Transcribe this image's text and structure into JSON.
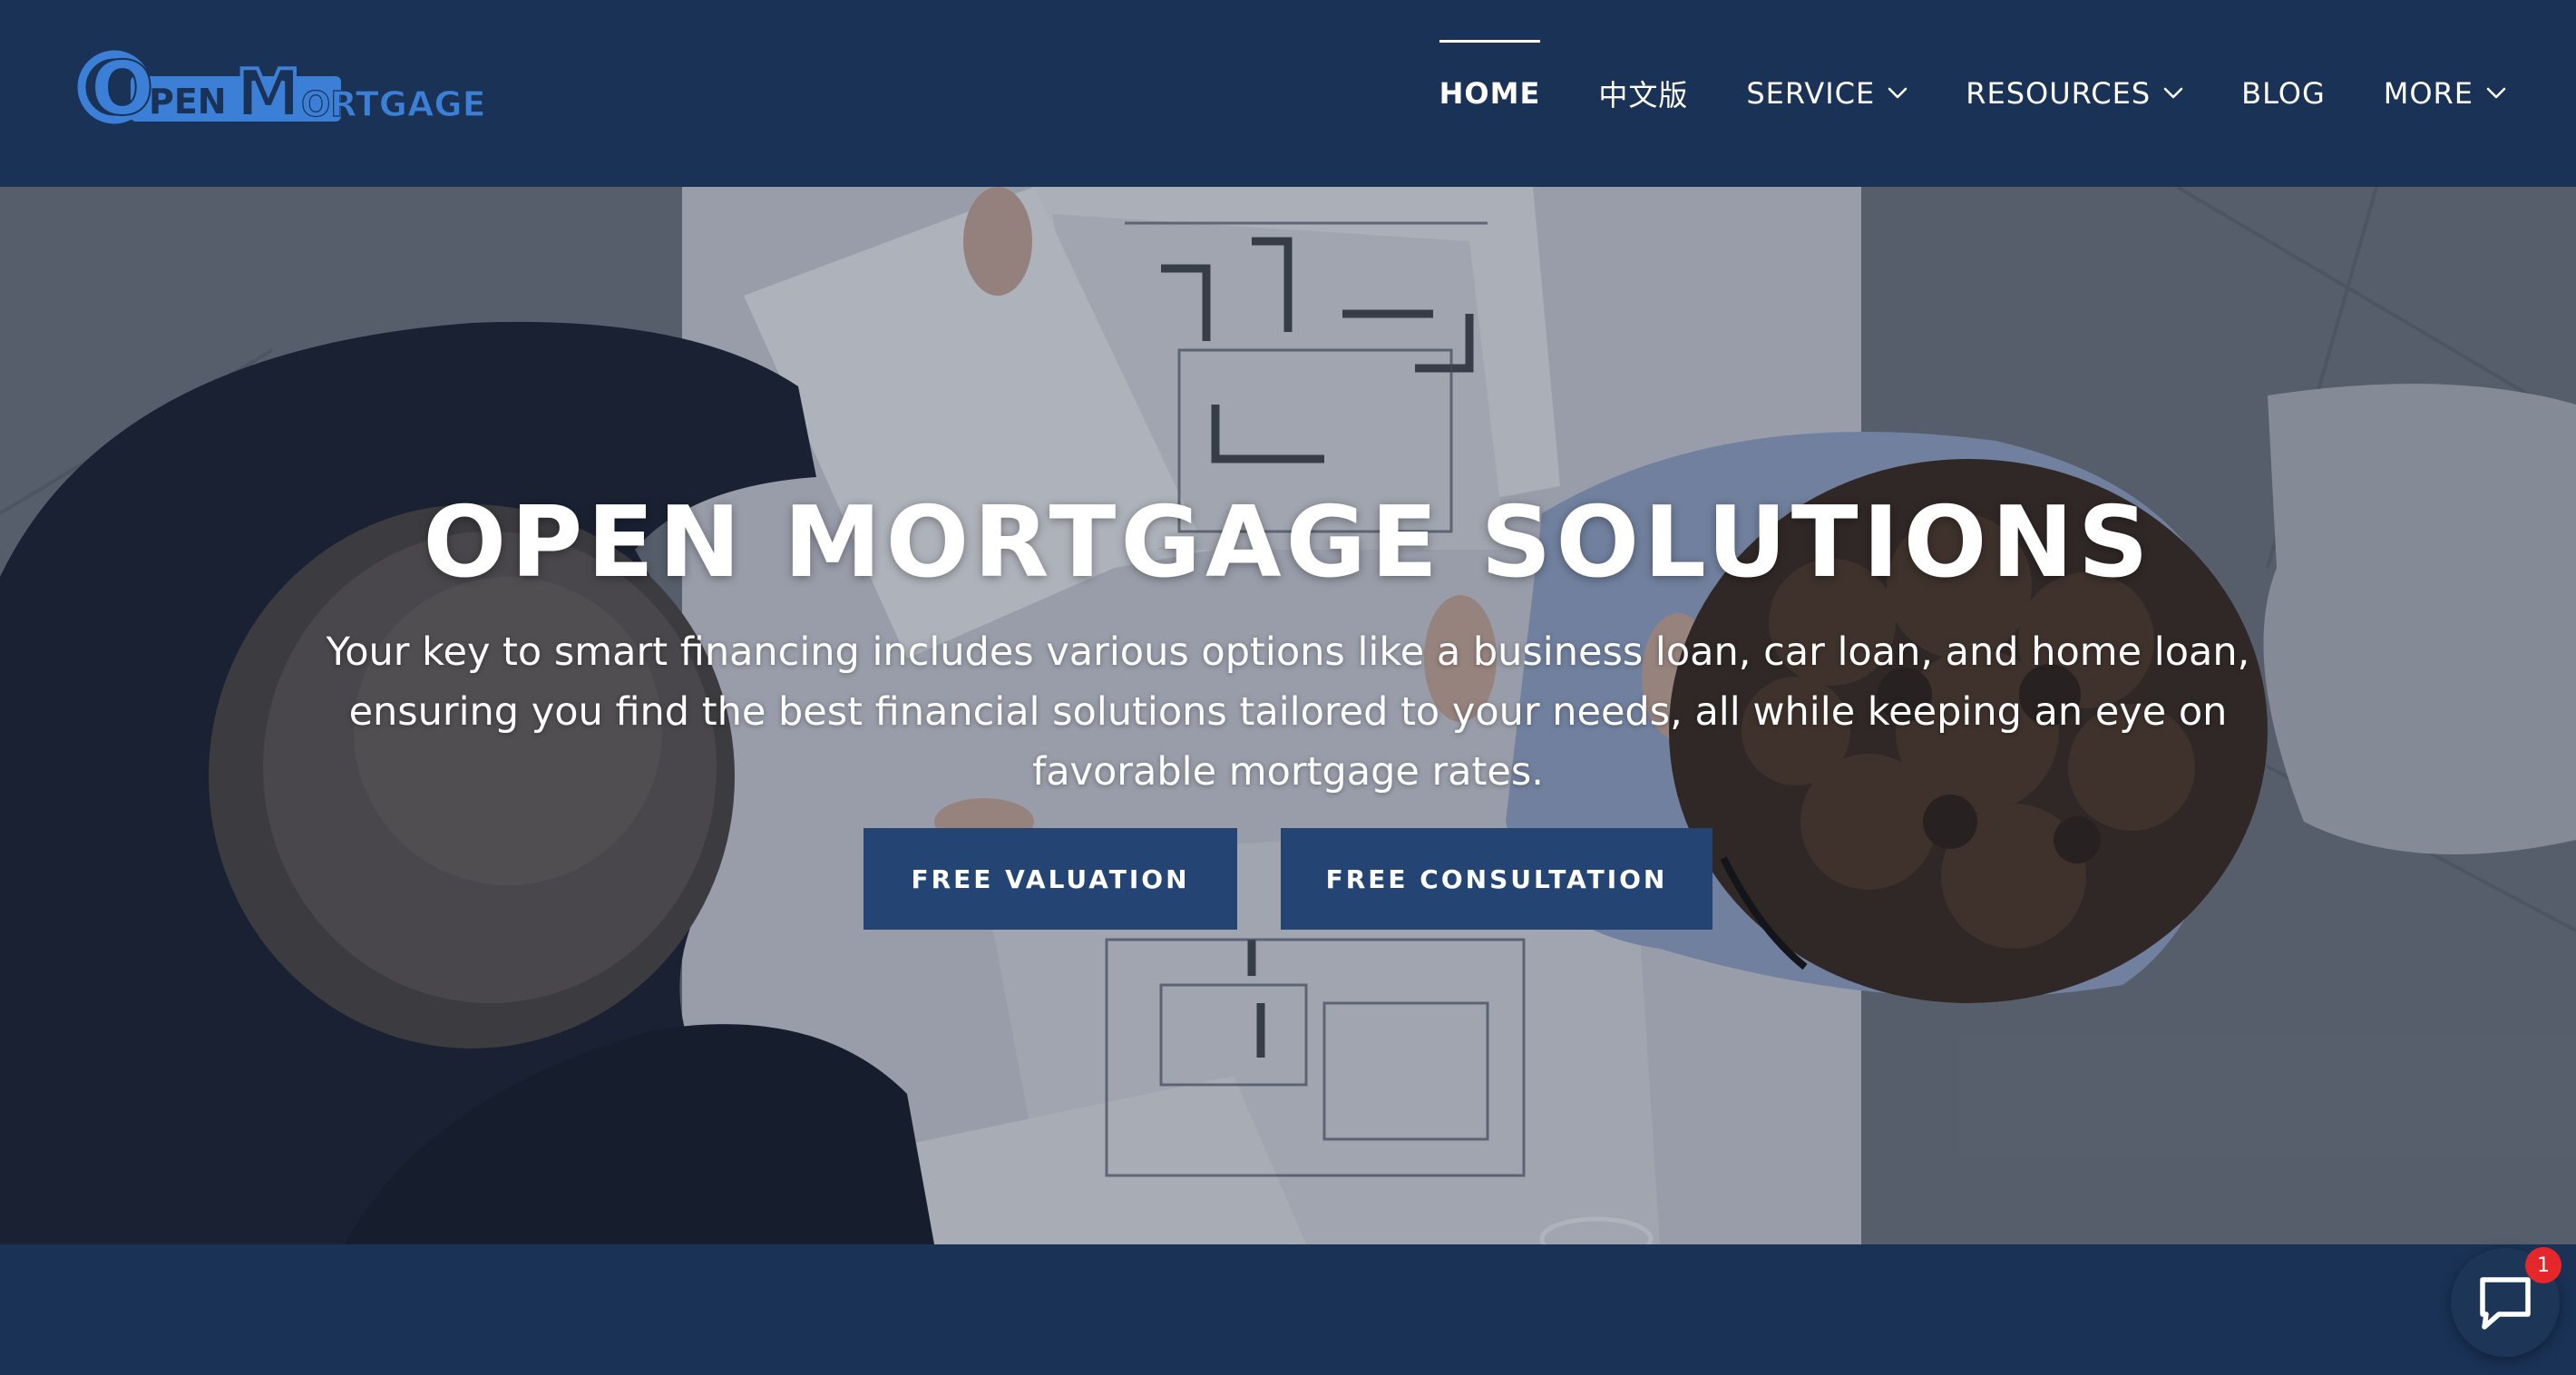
{
  "logo": {
    "text_parts": [
      "O",
      "PEN",
      "M",
      "ORTGAGE"
    ],
    "color": "#3b7fd6",
    "icon": "open-mortgage-logo"
  },
  "nav": {
    "items": [
      {
        "label": "HOME",
        "active": true,
        "has_dropdown": false
      },
      {
        "label": "中文版",
        "active": false,
        "has_dropdown": false
      },
      {
        "label": "SERVICE",
        "active": false,
        "has_dropdown": true
      },
      {
        "label": "RESOURCES",
        "active": false,
        "has_dropdown": true
      },
      {
        "label": "BLOG",
        "active": false,
        "has_dropdown": false
      },
      {
        "label": "MORE",
        "active": false,
        "has_dropdown": true
      }
    ],
    "dropdown_icon": "chevron-down-icon"
  },
  "hero": {
    "title": "OPEN MORTGAGE SOLUTIONS",
    "subtitle_lines": [
      "Your key to smart financing includes various options like a business loan, car loan, and home loan,",
      "ensuring you find the best financial solutions tailored to your needs, all while keeping an eye on",
      "favorable mortgage rates."
    ],
    "buttons": {
      "valuation": "FREE VALUATION",
      "consultation": "FREE CONSULTATION"
    },
    "background_image": "overhead-photo-two-people-reviewing-floor-plans"
  },
  "chat": {
    "icon": "chat-bubble-icon",
    "badge_count": "1"
  },
  "colors": {
    "header_bg": "#1a3256",
    "button_bg": "#244573",
    "badge": "#e5262a",
    "logo_blue": "#3b7fd6"
  }
}
